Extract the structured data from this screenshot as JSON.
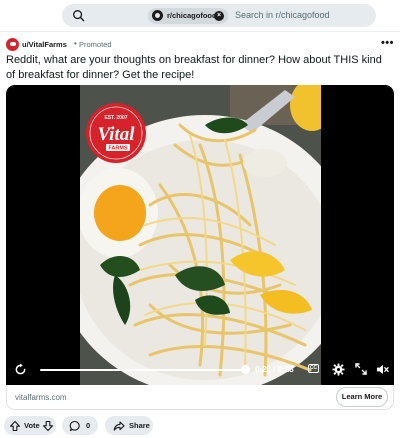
{
  "search": {
    "community_chip": "r/chicagofood",
    "chip_clear_icon": "close-icon",
    "placeholder": "Search in r/chicagofood",
    "icon": "search-icon"
  },
  "post": {
    "author": "u/VitalFarms",
    "separator": "•",
    "promoted_label": "Promoted",
    "more_label": "•••",
    "title": "Reddit, what are your thoughts on breakfast for dinner? How about THIS kind of breakfast for dinner? Get the recipe!"
  },
  "video": {
    "logo_top": "EST. 2007",
    "logo_main": "Vital",
    "logo_sub": "FARMS",
    "progress_fraction": 1.0,
    "time_text": "0:28 / 0:28",
    "cc_label": "CC",
    "icons": [
      "replay-icon",
      "closed-captions-icon",
      "settings-gear-icon",
      "expand-icon",
      "mute-icon"
    ]
  },
  "link": {
    "domain": "vitalfarms.com",
    "cta_label": "Learn More"
  },
  "actions": {
    "vote_label": "Vote",
    "comment_count": "0",
    "share_label": "Share"
  },
  "colors": {
    "search_bg": "#e5ebee",
    "brand_red": "#d6232b",
    "pill_bg": "#e5ebee"
  }
}
